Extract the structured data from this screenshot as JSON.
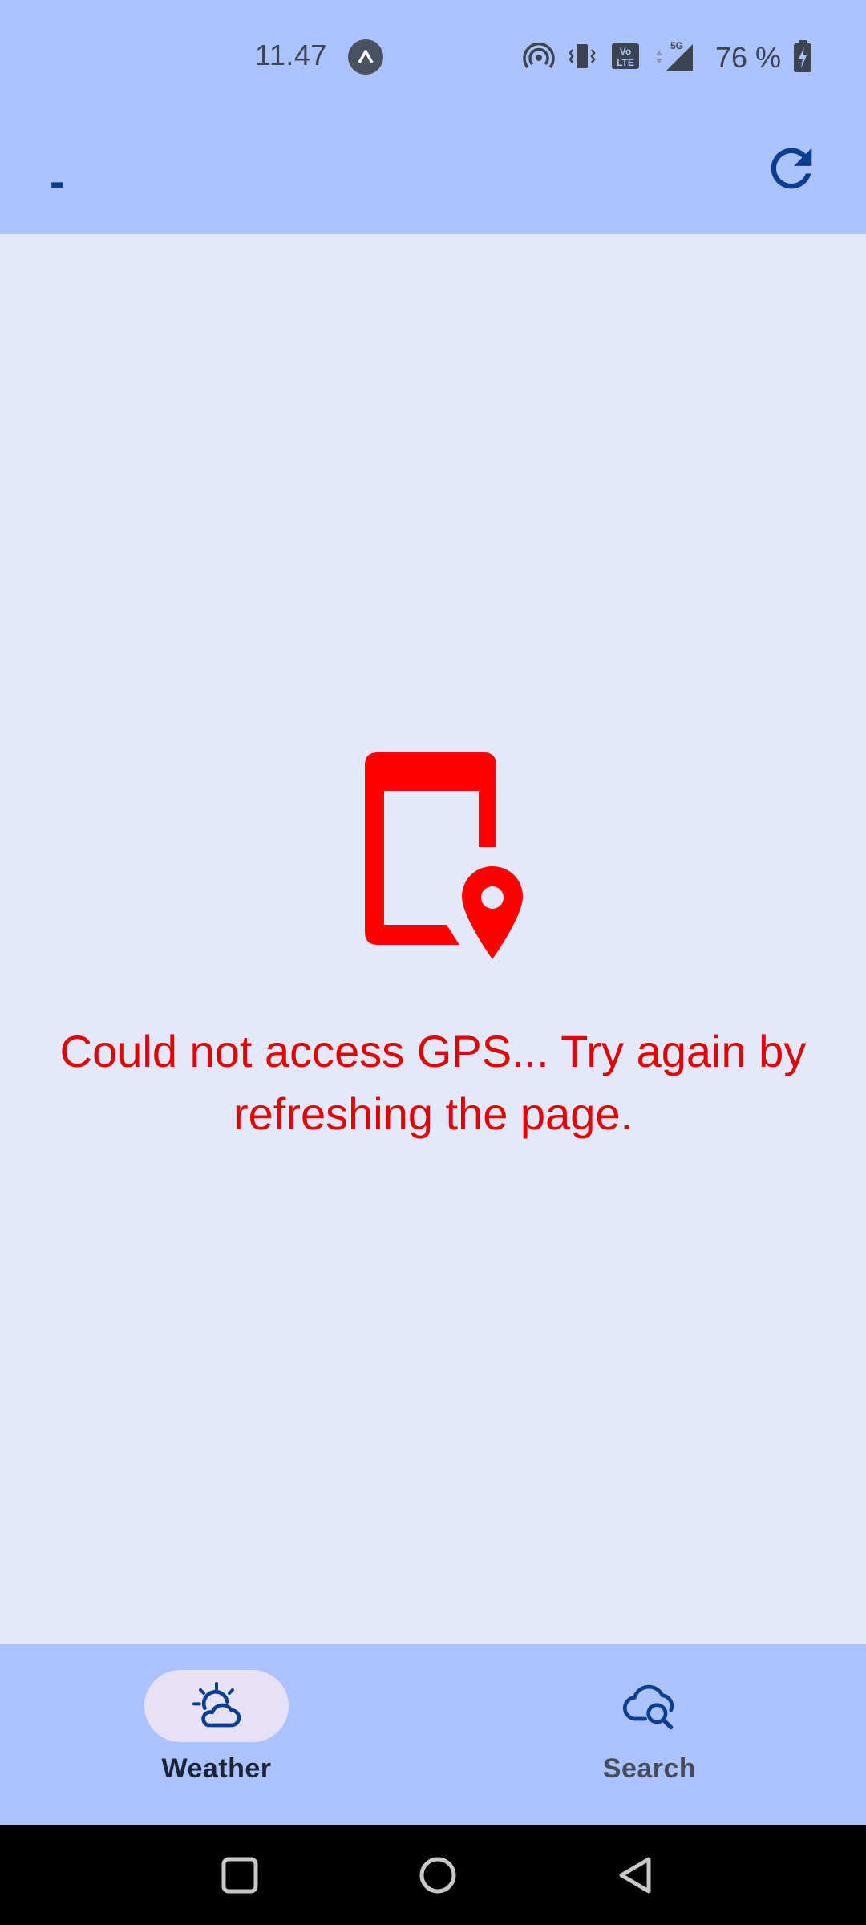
{
  "status_bar": {
    "time": "11.47",
    "battery": "76 %",
    "icons": [
      "navigation-indicator-icon",
      "hotspot-icon",
      "vibrate-icon",
      "volte-icon",
      "5g-signal-icon",
      "battery-charging-icon"
    ]
  },
  "app_bar": {
    "title": "-",
    "refresh_icon": "refresh-icon"
  },
  "main": {
    "error_icon": "phone-location-icon",
    "error_message": "Could not access GPS... Try again by refreshing the page."
  },
  "bottom_nav": {
    "items": [
      {
        "label": "Weather",
        "icon": "weather-partly-cloudy-icon",
        "active": true
      },
      {
        "label": "Search",
        "icon": "cloud-search-icon",
        "active": false
      }
    ]
  },
  "system_nav": {
    "buttons": [
      "recents-button",
      "home-button",
      "back-button"
    ]
  },
  "colors": {
    "bar_background": "#abc2fc",
    "page_background": "#e3e8fb",
    "primary": "#0b3d91",
    "error": "#e20000",
    "active_pill": "#e6e1f7"
  }
}
